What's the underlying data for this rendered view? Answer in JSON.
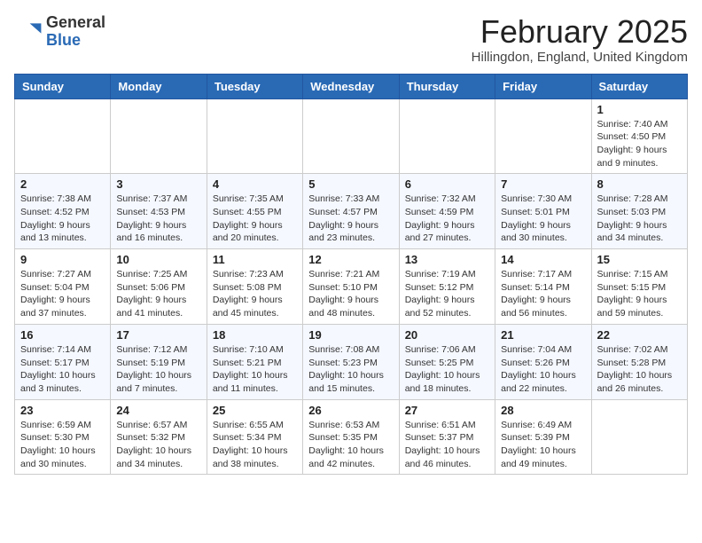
{
  "header": {
    "logo_general": "General",
    "logo_blue": "Blue",
    "title": "February 2025",
    "subtitle": "Hillingdon, England, United Kingdom"
  },
  "weekdays": [
    "Sunday",
    "Monday",
    "Tuesday",
    "Wednesday",
    "Thursday",
    "Friday",
    "Saturday"
  ],
  "weeks": [
    [
      {
        "day": "",
        "info": ""
      },
      {
        "day": "",
        "info": ""
      },
      {
        "day": "",
        "info": ""
      },
      {
        "day": "",
        "info": ""
      },
      {
        "day": "",
        "info": ""
      },
      {
        "day": "",
        "info": ""
      },
      {
        "day": "1",
        "info": "Sunrise: 7:40 AM\nSunset: 4:50 PM\nDaylight: 9 hours and 9 minutes."
      }
    ],
    [
      {
        "day": "2",
        "info": "Sunrise: 7:38 AM\nSunset: 4:52 PM\nDaylight: 9 hours and 13 minutes."
      },
      {
        "day": "3",
        "info": "Sunrise: 7:37 AM\nSunset: 4:53 PM\nDaylight: 9 hours and 16 minutes."
      },
      {
        "day": "4",
        "info": "Sunrise: 7:35 AM\nSunset: 4:55 PM\nDaylight: 9 hours and 20 minutes."
      },
      {
        "day": "5",
        "info": "Sunrise: 7:33 AM\nSunset: 4:57 PM\nDaylight: 9 hours and 23 minutes."
      },
      {
        "day": "6",
        "info": "Sunrise: 7:32 AM\nSunset: 4:59 PM\nDaylight: 9 hours and 27 minutes."
      },
      {
        "day": "7",
        "info": "Sunrise: 7:30 AM\nSunset: 5:01 PM\nDaylight: 9 hours and 30 minutes."
      },
      {
        "day": "8",
        "info": "Sunrise: 7:28 AM\nSunset: 5:03 PM\nDaylight: 9 hours and 34 minutes."
      }
    ],
    [
      {
        "day": "9",
        "info": "Sunrise: 7:27 AM\nSunset: 5:04 PM\nDaylight: 9 hours and 37 minutes."
      },
      {
        "day": "10",
        "info": "Sunrise: 7:25 AM\nSunset: 5:06 PM\nDaylight: 9 hours and 41 minutes."
      },
      {
        "day": "11",
        "info": "Sunrise: 7:23 AM\nSunset: 5:08 PM\nDaylight: 9 hours and 45 minutes."
      },
      {
        "day": "12",
        "info": "Sunrise: 7:21 AM\nSunset: 5:10 PM\nDaylight: 9 hours and 48 minutes."
      },
      {
        "day": "13",
        "info": "Sunrise: 7:19 AM\nSunset: 5:12 PM\nDaylight: 9 hours and 52 minutes."
      },
      {
        "day": "14",
        "info": "Sunrise: 7:17 AM\nSunset: 5:14 PM\nDaylight: 9 hours and 56 minutes."
      },
      {
        "day": "15",
        "info": "Sunrise: 7:15 AM\nSunset: 5:15 PM\nDaylight: 9 hours and 59 minutes."
      }
    ],
    [
      {
        "day": "16",
        "info": "Sunrise: 7:14 AM\nSunset: 5:17 PM\nDaylight: 10 hours and 3 minutes."
      },
      {
        "day": "17",
        "info": "Sunrise: 7:12 AM\nSunset: 5:19 PM\nDaylight: 10 hours and 7 minutes."
      },
      {
        "day": "18",
        "info": "Sunrise: 7:10 AM\nSunset: 5:21 PM\nDaylight: 10 hours and 11 minutes."
      },
      {
        "day": "19",
        "info": "Sunrise: 7:08 AM\nSunset: 5:23 PM\nDaylight: 10 hours and 15 minutes."
      },
      {
        "day": "20",
        "info": "Sunrise: 7:06 AM\nSunset: 5:25 PM\nDaylight: 10 hours and 18 minutes."
      },
      {
        "day": "21",
        "info": "Sunrise: 7:04 AM\nSunset: 5:26 PM\nDaylight: 10 hours and 22 minutes."
      },
      {
        "day": "22",
        "info": "Sunrise: 7:02 AM\nSunset: 5:28 PM\nDaylight: 10 hours and 26 minutes."
      }
    ],
    [
      {
        "day": "23",
        "info": "Sunrise: 6:59 AM\nSunset: 5:30 PM\nDaylight: 10 hours and 30 minutes."
      },
      {
        "day": "24",
        "info": "Sunrise: 6:57 AM\nSunset: 5:32 PM\nDaylight: 10 hours and 34 minutes."
      },
      {
        "day": "25",
        "info": "Sunrise: 6:55 AM\nSunset: 5:34 PM\nDaylight: 10 hours and 38 minutes."
      },
      {
        "day": "26",
        "info": "Sunrise: 6:53 AM\nSunset: 5:35 PM\nDaylight: 10 hours and 42 minutes."
      },
      {
        "day": "27",
        "info": "Sunrise: 6:51 AM\nSunset: 5:37 PM\nDaylight: 10 hours and 46 minutes."
      },
      {
        "day": "28",
        "info": "Sunrise: 6:49 AM\nSunset: 5:39 PM\nDaylight: 10 hours and 49 minutes."
      },
      {
        "day": "",
        "info": ""
      }
    ]
  ]
}
